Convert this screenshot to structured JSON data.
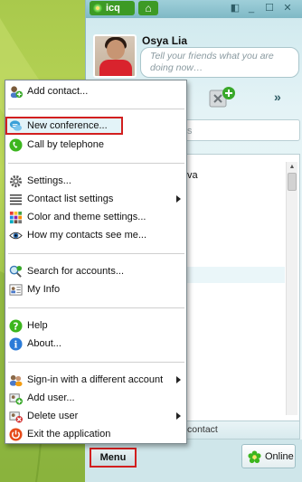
{
  "window": {
    "brand": "icq",
    "profile": {
      "name": "Osya Lia",
      "status_placeholder": "Tell your friends what you are doing now…"
    },
    "search_placeholder": "s",
    "contact_partial": "va",
    "add_contact_strip": "contact",
    "bottom": {
      "menu_label": "Menu",
      "status_label": "Online"
    }
  },
  "menu": {
    "items": [
      {
        "label": "Add contact...",
        "icon": "add-contact-icon"
      },
      {
        "label": "New conference...",
        "icon": "conference-icon"
      },
      {
        "label": "Call by telephone",
        "icon": "phone-icon"
      },
      {
        "label": "Settings...",
        "icon": "gear-icon"
      },
      {
        "label": "Contact list settings",
        "icon": "list-icon",
        "submenu": true
      },
      {
        "label": "Color and theme settings...",
        "icon": "palette-icon"
      },
      {
        "label": "How my contacts see me...",
        "icon": "eye-icon"
      },
      {
        "label": "Search for accounts...",
        "icon": "search-icon"
      },
      {
        "label": "My Info",
        "icon": "info-card-icon"
      },
      {
        "label": "Help",
        "icon": "help-icon"
      },
      {
        "label": "About...",
        "icon": "info-icon"
      },
      {
        "label": "Sign-in with a different account",
        "icon": "sign-in-icon",
        "submenu": true
      },
      {
        "label": "Add user...",
        "icon": "add-user-icon"
      },
      {
        "label": "Delete user",
        "icon": "delete-user-icon",
        "submenu": true
      },
      {
        "label": "Exit the application",
        "icon": "power-icon"
      }
    ]
  },
  "colors": {
    "highlight_outline": "#d21f1f",
    "icq_green": "#3d9a25",
    "menu_hover": "#e3f3f8"
  }
}
